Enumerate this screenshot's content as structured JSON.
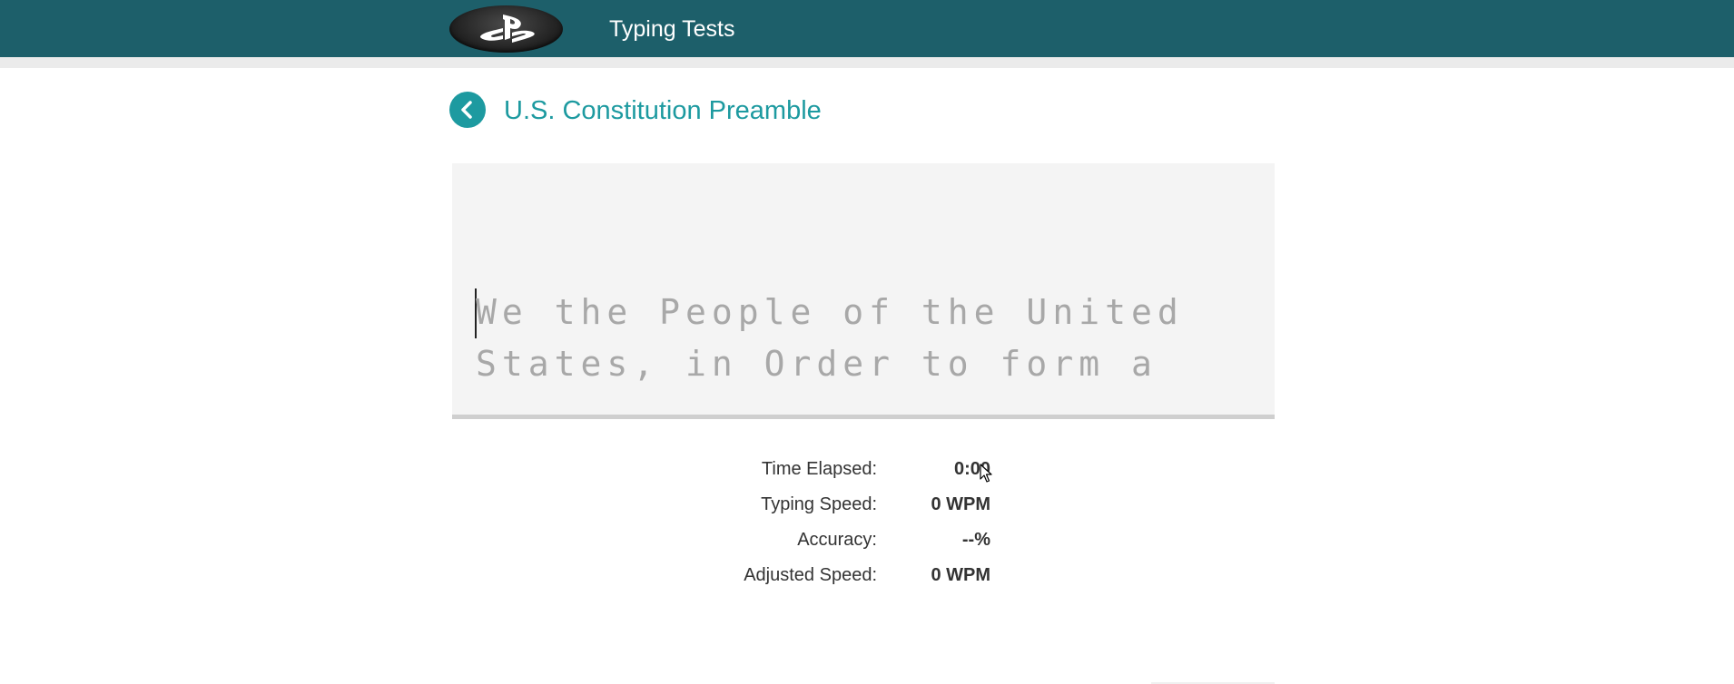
{
  "header": {
    "logo_icon": "playstation-logo-icon",
    "title": "Typing Tests",
    "background_color": "#1d5f6a"
  },
  "test": {
    "back_icon": "chevron-left-icon",
    "title": "U.S. Constitution Preamble",
    "accent_color": "#1d9aa0",
    "passage_visible": "We the People of the United States, in Order to form a"
  },
  "stats": [
    {
      "label": "Time Elapsed:",
      "value": "0:00"
    },
    {
      "label": "Typing Speed:",
      "value": "0 WPM"
    },
    {
      "label": "Accuracy:",
      "value": "--%"
    },
    {
      "label": "Adjusted Speed:",
      "value": "0 WPM"
    }
  ]
}
